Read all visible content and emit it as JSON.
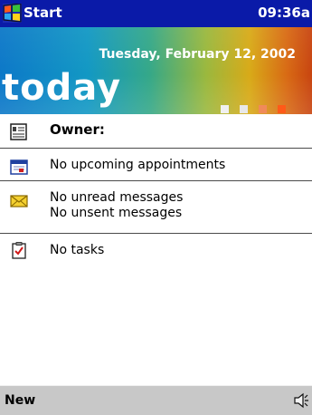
{
  "taskbar": {
    "start_label": "Start",
    "clock": "09:36a"
  },
  "banner": {
    "date": "Tuesday, February 12, 2002",
    "title": "today",
    "square_colors": [
      "#f0f0f0",
      "#e8e8e8",
      "#f08a5a",
      "#ff5a18"
    ]
  },
  "items": {
    "owner": {
      "label": "Owner:",
      "icon": "owner-card-icon"
    },
    "appointments": {
      "label": "No upcoming appointments",
      "icon": "calendar-icon"
    },
    "messages": {
      "line1": "No unread messages",
      "line2": "No unsent messages",
      "icon": "envelope-icon"
    },
    "tasks": {
      "label": "No tasks",
      "icon": "tasks-clipboard-icon"
    }
  },
  "bottombar": {
    "new_label": "New",
    "speaker_icon": "speaker-icon"
  },
  "colors": {
    "taskbar": "#0a1aa8",
    "bottombar": "#c8c8c8"
  }
}
